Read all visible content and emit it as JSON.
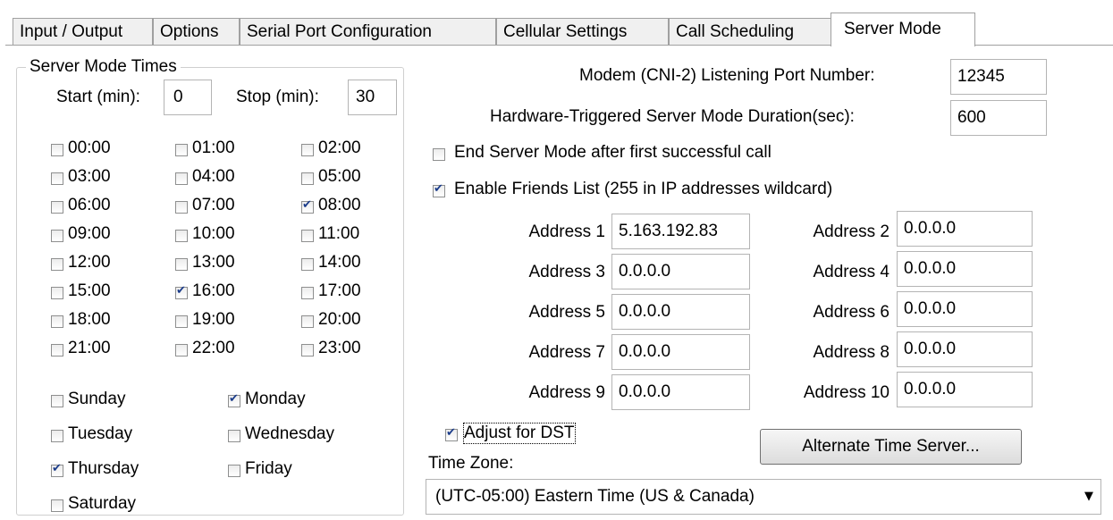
{
  "tabs": [
    "Input / Output",
    "Options",
    "Serial Port Configuration",
    "Cellular Settings",
    "Call Scheduling",
    "Server Mode"
  ],
  "active_tab": "Server Mode",
  "server_mode_times": {
    "title": "Server Mode Times",
    "start_label": "Start (min):",
    "start_value": "0",
    "stop_label": "Stop (min):",
    "stop_value": "30",
    "hours": [
      {
        "label": "00:00",
        "checked": false
      },
      {
        "label": "01:00",
        "checked": false
      },
      {
        "label": "02:00",
        "checked": false
      },
      {
        "label": "03:00",
        "checked": false
      },
      {
        "label": "04:00",
        "checked": false
      },
      {
        "label": "05:00",
        "checked": false
      },
      {
        "label": "06:00",
        "checked": false
      },
      {
        "label": "07:00",
        "checked": false
      },
      {
        "label": "08:00",
        "checked": true
      },
      {
        "label": "09:00",
        "checked": false
      },
      {
        "label": "10:00",
        "checked": false
      },
      {
        "label": "11:00",
        "checked": false
      },
      {
        "label": "12:00",
        "checked": false
      },
      {
        "label": "13:00",
        "checked": false
      },
      {
        "label": "14:00",
        "checked": false
      },
      {
        "label": "15:00",
        "checked": false
      },
      {
        "label": "16:00",
        "checked": true
      },
      {
        "label": "17:00",
        "checked": false
      },
      {
        "label": "18:00",
        "checked": false
      },
      {
        "label": "19:00",
        "checked": false
      },
      {
        "label": "20:00",
        "checked": false
      },
      {
        "label": "21:00",
        "checked": false
      },
      {
        "label": "22:00",
        "checked": false
      },
      {
        "label": "23:00",
        "checked": false
      }
    ],
    "days": [
      {
        "label": "Sunday",
        "checked": false
      },
      {
        "label": "Monday",
        "checked": true
      },
      {
        "label": "Tuesday",
        "checked": false
      },
      {
        "label": "Wednesday",
        "checked": false
      },
      {
        "label": "Thursday",
        "checked": true
      },
      {
        "label": "Friday",
        "checked": false
      },
      {
        "label": "Saturday",
        "checked": false
      }
    ]
  },
  "listening_port": {
    "label": "Modem (CNI-2) Listening Port Number:",
    "value": "12345"
  },
  "hw_duration": {
    "label": "Hardware-Triggered Server Mode Duration(sec):",
    "value": "600"
  },
  "end_after_call": {
    "label": "End Server Mode after first successful call",
    "checked": false
  },
  "friends_list": {
    "label": "Enable Friends List (255 in IP addresses wildcard)",
    "checked": true
  },
  "addresses": [
    {
      "label": "Address 1",
      "value": "5.163.192.83"
    },
    {
      "label": "Address 2",
      "value": "0.0.0.0"
    },
    {
      "label": "Address 3",
      "value": "0.0.0.0"
    },
    {
      "label": "Address 4",
      "value": "0.0.0.0"
    },
    {
      "label": "Address 5",
      "value": "0.0.0.0"
    },
    {
      "label": "Address 6",
      "value": "0.0.0.0"
    },
    {
      "label": "Address 7",
      "value": "0.0.0.0"
    },
    {
      "label": "Address 8",
      "value": "0.0.0.0"
    },
    {
      "label": "Address 9",
      "value": "0.0.0.0"
    },
    {
      "label": "Address 10",
      "value": "0.0.0.0"
    }
  ],
  "dst": {
    "label": "Adjust for DST",
    "checked": true
  },
  "alt_time_server_button": "Alternate Time Server...",
  "time_zone": {
    "label": "Time Zone:",
    "value": "(UTC-05:00) Eastern Time (US & Canada)"
  }
}
